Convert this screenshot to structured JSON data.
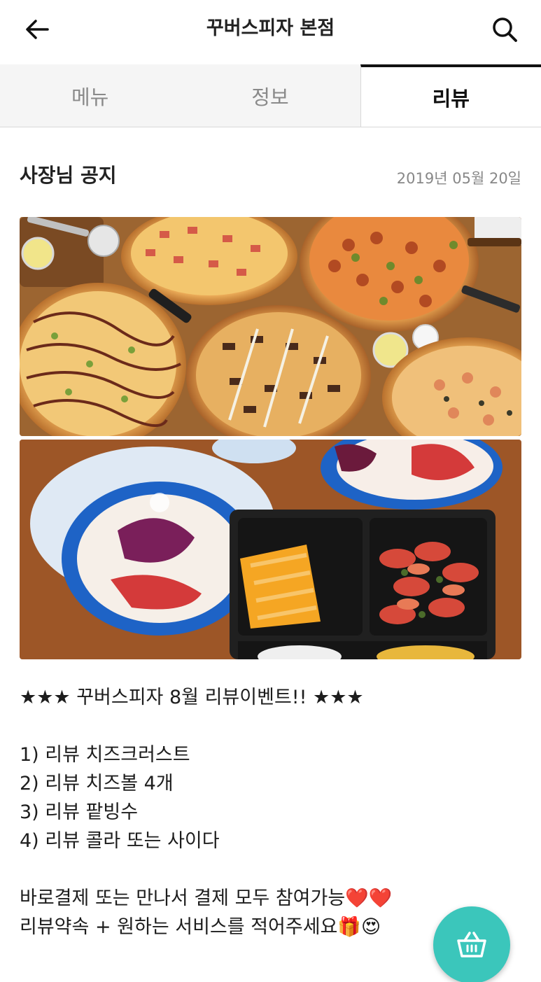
{
  "header": {
    "title": "꾸버스피자 본점",
    "back_icon": "arrow-left-icon",
    "search_icon": "search-icon"
  },
  "tabs": [
    {
      "label": "메뉴",
      "active": false
    },
    {
      "label": "정보",
      "active": false
    },
    {
      "label": "리뷰",
      "active": true
    }
  ],
  "notice": {
    "title": "사장님 공지",
    "date": "2019년 05월 20일",
    "photos": [
      "pizza-photo",
      "side-dishes-photo"
    ],
    "lines": [
      "★★★ 꾸버스피자  8월 리뷰이벤트!! ★★★",
      "",
      "1) 리뷰 치즈크러스트",
      "2) 리뷰 치즈볼 4개",
      "3) 리뷰 팥빙수",
      "4) 리뷰 콜라 또는 사이다",
      "",
      "바로결제 또는 만나서 결제 모두 참여가능❤️❤️",
      "리뷰약속 + 원하는 서비스를 적어주세요🎁😍"
    ]
  },
  "cart": {
    "icon": "basket-icon"
  },
  "colors": {
    "accent": "#3bc6bb",
    "active_tab_border": "#111111",
    "inactive_tab_text": "#8a8a8a",
    "date_text": "#888888"
  }
}
